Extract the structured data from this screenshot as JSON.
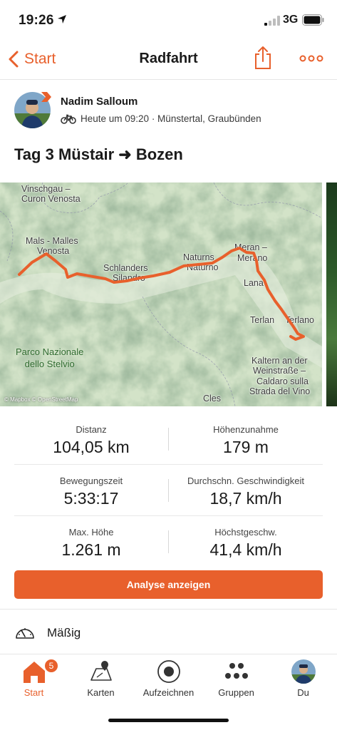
{
  "status_bar": {
    "time": "19:26",
    "network": "3G"
  },
  "nav": {
    "back_label": "Start",
    "title": "Radfahrt"
  },
  "athlete": {
    "name": "Nadim Salloum",
    "meta": "Heute um 09:20 · Münstertal, Graubünden"
  },
  "activity": {
    "title": "Tag 3 Müstair ➜ Bozen"
  },
  "map": {
    "labels": {
      "vinschgau": "Vinschgau –",
      "curon": "Curon Venosta",
      "mals": "Mals - Malles",
      "venosta": "Venosta",
      "schlanders": "Schlanders",
      "silandro": "Silandro",
      "naturns": "Naturns",
      "naturno": "Naturno",
      "meran": "Meran –",
      "merano": "Merano",
      "lana": "Lana",
      "terlan": "Terlan",
      "terlano": "Terlano",
      "kaltern1": "Kaltern an der",
      "kaltern2": "Weinstraße –",
      "kaltern3": "Caldaro sulla",
      "kaltern4": "Strada del Vino",
      "cles": "Cles",
      "park1": "Parco Nazionale",
      "park2": "dello Stelvio"
    },
    "attribution": "© Mapbox © OpenStreetMap",
    "route_color": "#e8602c"
  },
  "stats": [
    {
      "label": "Distanz",
      "value": "104,05 km"
    },
    {
      "label": "Höhenzunahme",
      "value": "179 m"
    },
    {
      "label": "Bewegungszeit",
      "value": "5:33:17"
    },
    {
      "label": "Durchschn. Geschwindigkeit",
      "value": "18,7 km/h"
    },
    {
      "label": "Max. Höhe",
      "value": "1.261 m"
    },
    {
      "label": "Höchstgeschw.",
      "value": "41,4 km/h"
    }
  ],
  "analyse_button": "Analyse anzeigen",
  "effort": {
    "label": "Mäßig",
    "icon": "gauge-icon"
  },
  "tabs": [
    {
      "label": "Start",
      "icon": "home-icon",
      "badge": "5",
      "active": true
    },
    {
      "label": "Karten",
      "icon": "map-icon"
    },
    {
      "label": "Aufzeichnen",
      "icon": "record-icon"
    },
    {
      "label": "Gruppen",
      "icon": "groups-icon"
    },
    {
      "label": "Du",
      "icon": "profile-avatar"
    }
  ],
  "colors": {
    "accent": "#e8602c",
    "text": "#1a1a1a",
    "divider": "#e6e6e6"
  }
}
